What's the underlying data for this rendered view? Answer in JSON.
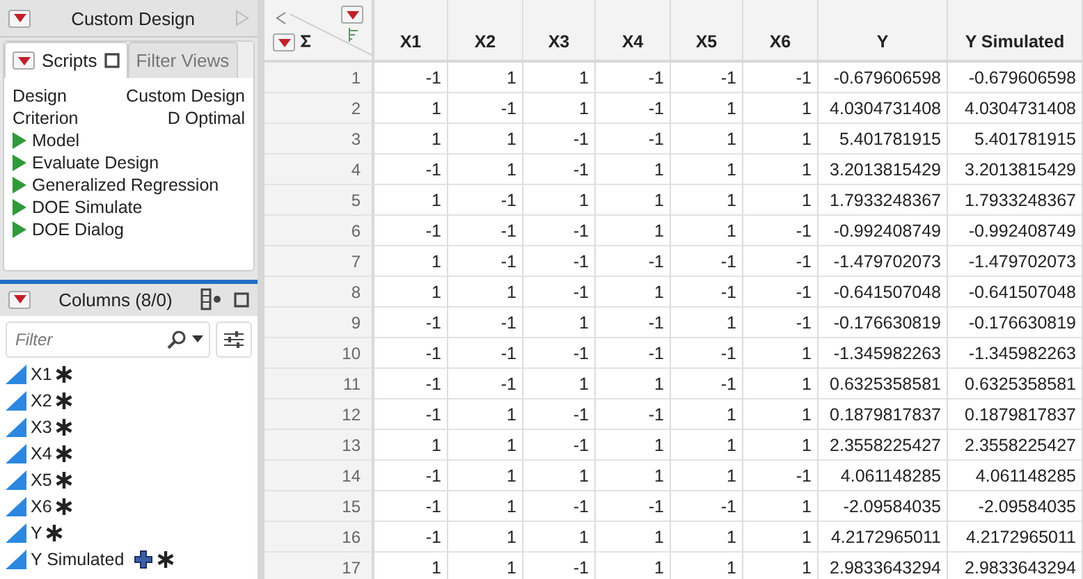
{
  "report": {
    "title": "Custom Design",
    "tabs": [
      {
        "label": "Scripts",
        "selected": true
      },
      {
        "label": "Filter Views",
        "selected": false
      }
    ],
    "info": [
      {
        "label": "Design",
        "value": "Custom Design"
      },
      {
        "label": "Criterion",
        "value": "D Optimal"
      }
    ],
    "scripts": [
      "Model",
      "Evaluate Design",
      "Generalized Regression",
      "DOE Simulate",
      "DOE Dialog"
    ]
  },
  "columns_panel": {
    "title": "Columns (8/0)",
    "filter": {
      "placeholder": "Filter"
    },
    "columns": [
      {
        "name": "X1",
        "formula": false
      },
      {
        "name": "X2",
        "formula": false
      },
      {
        "name": "X3",
        "formula": false
      },
      {
        "name": "X4",
        "formula": false
      },
      {
        "name": "X5",
        "formula": false
      },
      {
        "name": "X6",
        "formula": false
      },
      {
        "name": "Y",
        "formula": false
      },
      {
        "name": "Y Simulated",
        "formula": true
      }
    ]
  },
  "table": {
    "columns": [
      "X1",
      "X2",
      "X3",
      "X4",
      "X5",
      "X6",
      "Y",
      "Y Simulated"
    ],
    "rows": [
      {
        "row": "1",
        "cells": [
          "-1",
          "1",
          "1",
          "-1",
          "-1",
          "-1",
          "-0.679606598",
          "-0.679606598"
        ]
      },
      {
        "row": "2",
        "cells": [
          "1",
          "-1",
          "1",
          "-1",
          "1",
          "1",
          "4.0304731408",
          "4.0304731408"
        ]
      },
      {
        "row": "3",
        "cells": [
          "1",
          "1",
          "-1",
          "-1",
          "1",
          "1",
          "5.401781915",
          "5.401781915"
        ]
      },
      {
        "row": "4",
        "cells": [
          "-1",
          "1",
          "-1",
          "1",
          "1",
          "1",
          "3.2013815429",
          "3.2013815429"
        ]
      },
      {
        "row": "5",
        "cells": [
          "1",
          "-1",
          "1",
          "1",
          "1",
          "1",
          "1.7933248367",
          "1.7933248367"
        ]
      },
      {
        "row": "6",
        "cells": [
          "-1",
          "-1",
          "-1",
          "1",
          "1",
          "-1",
          "-0.992408749",
          "-0.992408749"
        ]
      },
      {
        "row": "7",
        "cells": [
          "1",
          "-1",
          "-1",
          "-1",
          "-1",
          "-1",
          "-1.479702073",
          "-1.479702073"
        ]
      },
      {
        "row": "8",
        "cells": [
          "1",
          "1",
          "-1",
          "1",
          "-1",
          "-1",
          "-0.641507048",
          "-0.641507048"
        ]
      },
      {
        "row": "9",
        "cells": [
          "-1",
          "-1",
          "1",
          "-1",
          "1",
          "-1",
          "-0.176630819",
          "-0.176630819"
        ]
      },
      {
        "row": "10",
        "cells": [
          "-1",
          "-1",
          "-1",
          "-1",
          "-1",
          "1",
          "-1.345982263",
          "-1.345982263"
        ]
      },
      {
        "row": "11",
        "cells": [
          "-1",
          "-1",
          "1",
          "1",
          "-1",
          "1",
          "0.6325358581",
          "0.6325358581"
        ]
      },
      {
        "row": "12",
        "cells": [
          "-1",
          "1",
          "-1",
          "-1",
          "1",
          "1",
          "0.1879817837",
          "0.1879817837"
        ]
      },
      {
        "row": "13",
        "cells": [
          "1",
          "1",
          "-1",
          "1",
          "1",
          "1",
          "2.3558225427",
          "2.3558225427"
        ]
      },
      {
        "row": "14",
        "cells": [
          "-1",
          "1",
          "1",
          "1",
          "1",
          "-1",
          "4.061148285",
          "4.061148285"
        ]
      },
      {
        "row": "15",
        "cells": [
          "-1",
          "1",
          "-1",
          "-1",
          "-1",
          "1",
          "-2.09584035",
          "-2.09584035"
        ]
      },
      {
        "row": "16",
        "cells": [
          "-1",
          "1",
          "1",
          "1",
          "1",
          "1",
          "4.2172965011",
          "4.2172965011"
        ]
      },
      {
        "row": "17",
        "cells": [
          "1",
          "1",
          "-1",
          "1",
          "1",
          "1",
          "2.9833643294",
          "2.9833643294"
        ]
      }
    ]
  }
}
